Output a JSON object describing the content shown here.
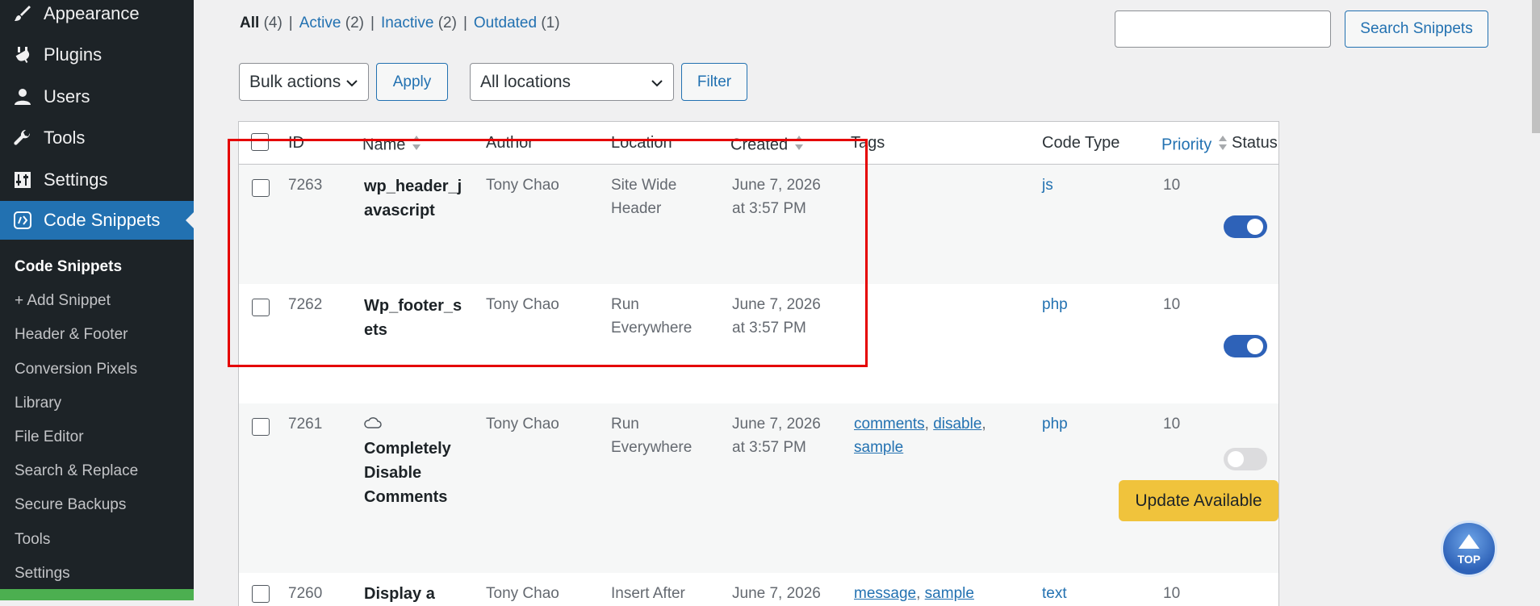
{
  "sidebar": {
    "menu": [
      {
        "label": "Appearance",
        "icon": "paintbrush-icon"
      },
      {
        "label": "Plugins",
        "icon": "plugin-icon"
      },
      {
        "label": "Users",
        "icon": "user-icon"
      },
      {
        "label": "Tools",
        "icon": "wrench-icon"
      },
      {
        "label": "Settings",
        "icon": "settings-icon"
      },
      {
        "label": "Code Snippets",
        "icon": "code-snippets-icon",
        "active": true
      }
    ],
    "submenu": [
      "Code Snippets",
      "+ Add Snippet",
      "Header & Footer",
      "Conversion Pixels",
      "Library",
      "File Editor",
      "Search & Replace",
      "Secure Backups",
      "Tools",
      "Settings"
    ]
  },
  "filters": {
    "all": "All",
    "all_count": "(4)",
    "active": "Active",
    "active_count": "(2)",
    "inactive": "Inactive",
    "inactive_count": "(2)",
    "outdated": "Outdated",
    "outdated_count": "(1)",
    "separator": "|"
  },
  "search": {
    "value": "",
    "button": "Search Snippets"
  },
  "toolbar": {
    "bulk_actions": "Bulk actions",
    "apply": "Apply",
    "locations": "All locations",
    "filter": "Filter"
  },
  "table": {
    "columns": [
      "ID",
      "Name",
      "Author",
      "Location",
      "Created",
      "Tags",
      "Code Type",
      "Priority",
      "Status"
    ],
    "rows": [
      {
        "id": "7263",
        "name": [
          "wp_header_j",
          "avascript"
        ],
        "author": "Tony Chao",
        "location": [
          "Site Wide",
          "Header"
        ],
        "created": [
          "June 7, 2026",
          "at 3:57 PM"
        ],
        "tags": [],
        "code_type": "js",
        "priority": "10",
        "active": true
      },
      {
        "id": "7262",
        "name": [
          "Wp_footer_s",
          "ets"
        ],
        "author": "Tony Chao",
        "location": [
          "Run",
          "Everywhere"
        ],
        "created": [
          "June 7, 2026",
          "at 3:57 PM"
        ],
        "tags": [],
        "code_type": "php",
        "priority": "10",
        "active": true
      },
      {
        "id": "7261",
        "name": [
          "Completely",
          "Disable",
          "Comments"
        ],
        "author": "Tony Chao",
        "location": [
          "Run",
          "Everywhere"
        ],
        "created": [
          "June 7, 2026",
          "at 3:57 PM"
        ],
        "tags": [
          "comments",
          "disable",
          "sample"
        ],
        "code_type": "php",
        "priority": "10",
        "active": false,
        "update_label": "Update Available"
      },
      {
        "id": "7260",
        "name": [
          "Display a"
        ],
        "author": "Tony Chao",
        "location": [
          "Insert After"
        ],
        "created": [
          "June 7, 2026"
        ],
        "tags": [
          "message",
          "sample"
        ],
        "code_type": "text",
        "priority": "10",
        "active": false
      }
    ]
  },
  "top_button": "TOP",
  "colors": {
    "accent": "#2271b1",
    "sidebar": "#1d2327",
    "highlight": "#e50000",
    "update": "#f0c33c"
  }
}
